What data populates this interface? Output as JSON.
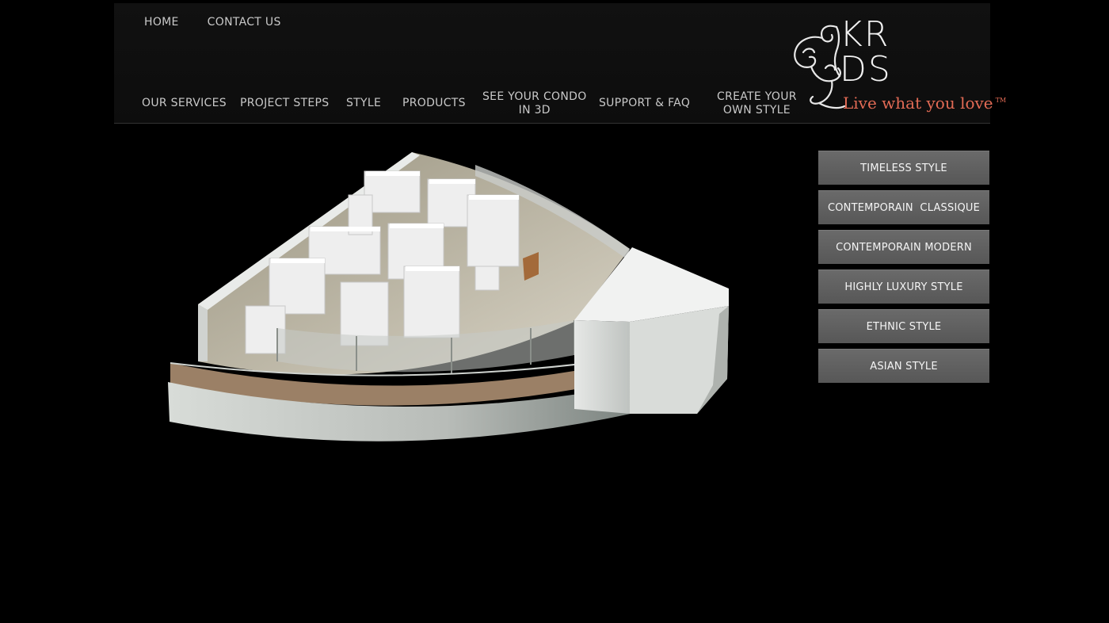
{
  "top_nav": {
    "home": "HOME",
    "contact": "CONTACT US"
  },
  "main_nav": {
    "services": "OUR SERVICES",
    "steps": "PROJECT STEPS",
    "style": "STYLE",
    "products": "PRODUCTS",
    "condo_3d": "SEE YOUR CONDO\nIN 3D",
    "support": "SUPPORT & FAQ",
    "create_style": "CREATE YOUR\nOWN STYLE"
  },
  "logo": {
    "letters_top": "KR",
    "letters_bottom": "DS",
    "tagline": "Live what you love",
    "tm": "TM",
    "tagline_color": "#e36b55"
  },
  "style_buttons": [
    "TIMELESS STYLE",
    "CONTEMPORAIN  CLASSIQUE",
    "CONTEMPORAIN MODERN",
    "HIGHLY LUXURY STYLE",
    "ETHNIC STYLE",
    "ASIAN STYLE"
  ],
  "colors": {
    "background": "#000000",
    "header": "#111111",
    "button": "#5f5f5f",
    "nav_text": "#c9c9c9"
  }
}
